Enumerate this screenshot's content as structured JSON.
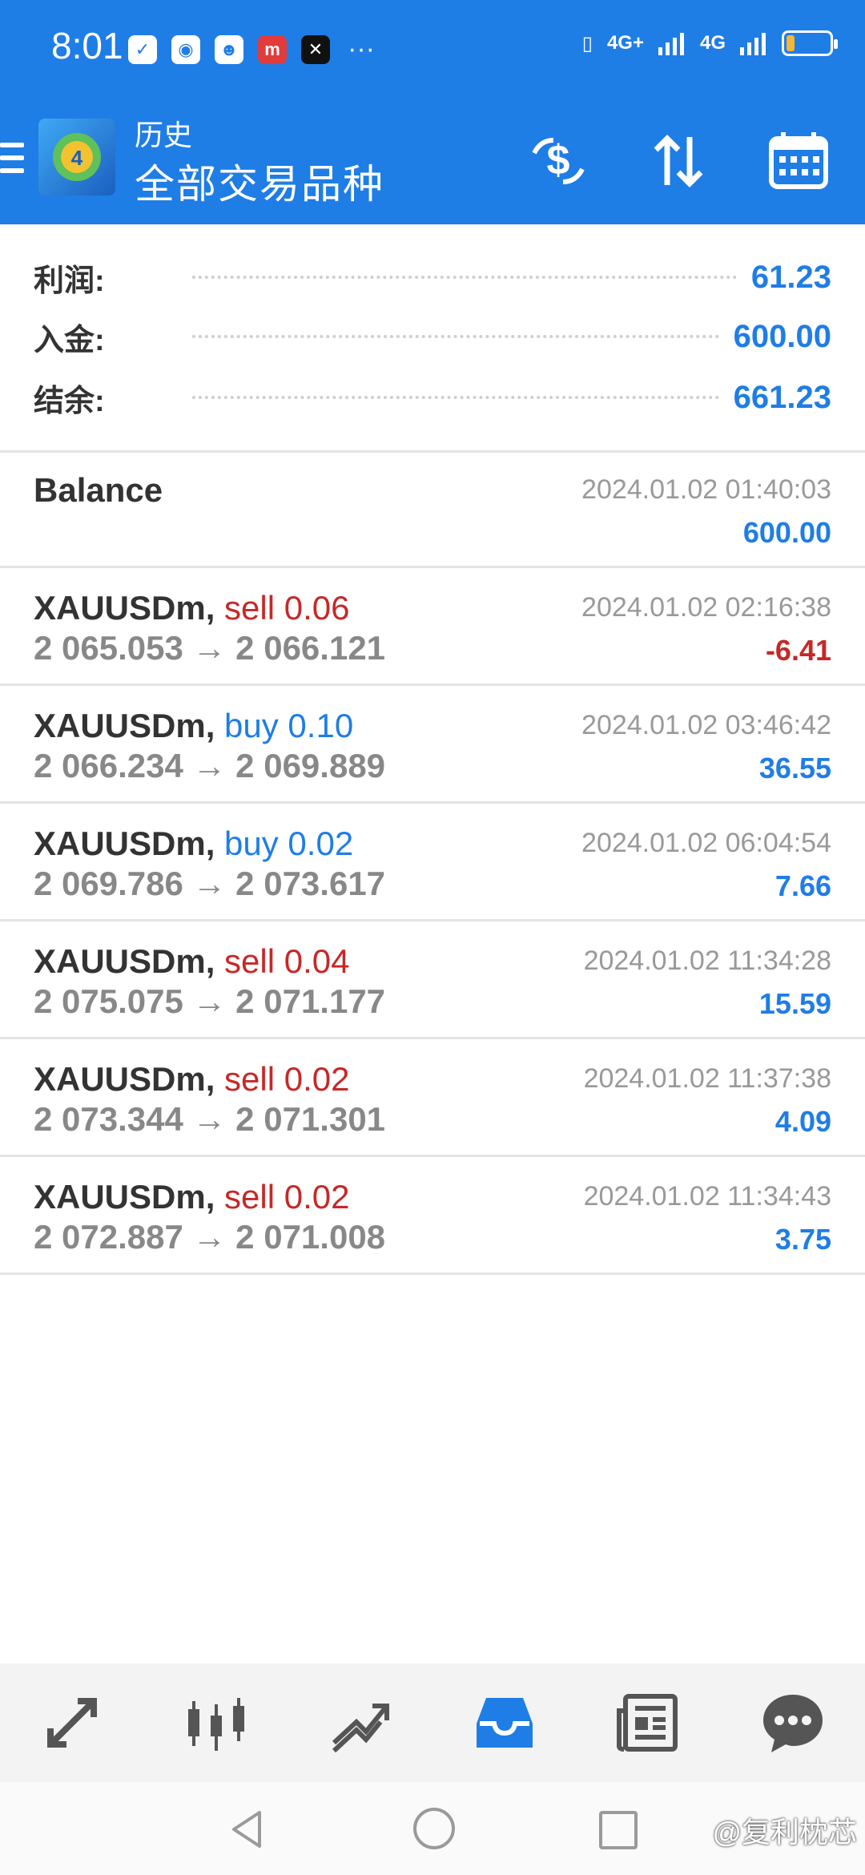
{
  "status_bar": {
    "time": "8:01",
    "network_1": "4G+",
    "network_2": "4G",
    "battery_level": 0.2,
    "battery_color": "#f7b733",
    "more_indicator": "···"
  },
  "app_bar": {
    "title": "历史",
    "subtitle": "全部交易品种",
    "background": "#1f7de6",
    "actions": [
      "dollar-exchange-icon",
      "sort-icon",
      "calendar-icon"
    ]
  },
  "summary": [
    {
      "label": "利润:",
      "value": "61.23"
    },
    {
      "label": "入金:",
      "value": "600.00"
    },
    {
      "label": "结余:",
      "value": "661.23"
    }
  ],
  "balance": {
    "label": "Balance",
    "time": "2024.01.02 01:40:03",
    "amount": "600.00"
  },
  "trades": [
    {
      "symbol": "XAUUSDm,",
      "side": "sell 0.06",
      "type": "sell",
      "prices": "2 065.053 → 2 066.121",
      "time": "2024.01.02 02:16:38",
      "profit": "-6.41",
      "negative": true
    },
    {
      "symbol": "XAUUSDm,",
      "side": "buy 0.10",
      "type": "buy",
      "prices": "2 066.234 → 2 069.889",
      "time": "2024.01.02 03:46:42",
      "profit": "36.55",
      "negative": false
    },
    {
      "symbol": "XAUUSDm,",
      "side": "buy 0.02",
      "type": "buy",
      "prices": "2 069.786 → 2 073.617",
      "time": "2024.01.02 06:04:54",
      "profit": "7.66",
      "negative": false
    },
    {
      "symbol": "XAUUSDm,",
      "side": "sell 0.04",
      "type": "sell",
      "prices": "2 075.075 → 2 071.177",
      "time": "2024.01.02 11:34:28",
      "profit": "15.59",
      "negative": false
    },
    {
      "symbol": "XAUUSDm,",
      "side": "sell 0.02",
      "type": "sell",
      "prices": "2 073.344 → 2 071.301",
      "time": "2024.01.02 11:37:38",
      "profit": "4.09",
      "negative": false
    },
    {
      "symbol": "XAUUSDm,",
      "side": "sell 0.02",
      "type": "sell",
      "prices": "2 072.887 → 2 071.008",
      "time": "2024.01.02 11:34:43",
      "profit": "3.75",
      "negative": false
    }
  ],
  "bottom_nav": {
    "items": [
      "quotes-icon",
      "chart-icon",
      "trade-icon",
      "history-icon",
      "news-icon",
      "chat-icon"
    ],
    "active": "history-icon",
    "active_color": "#1f7de6"
  },
  "watermark": "@复利枕芯",
  "colors": {
    "accent": "#1f7de6",
    "negative": "#c62828"
  }
}
